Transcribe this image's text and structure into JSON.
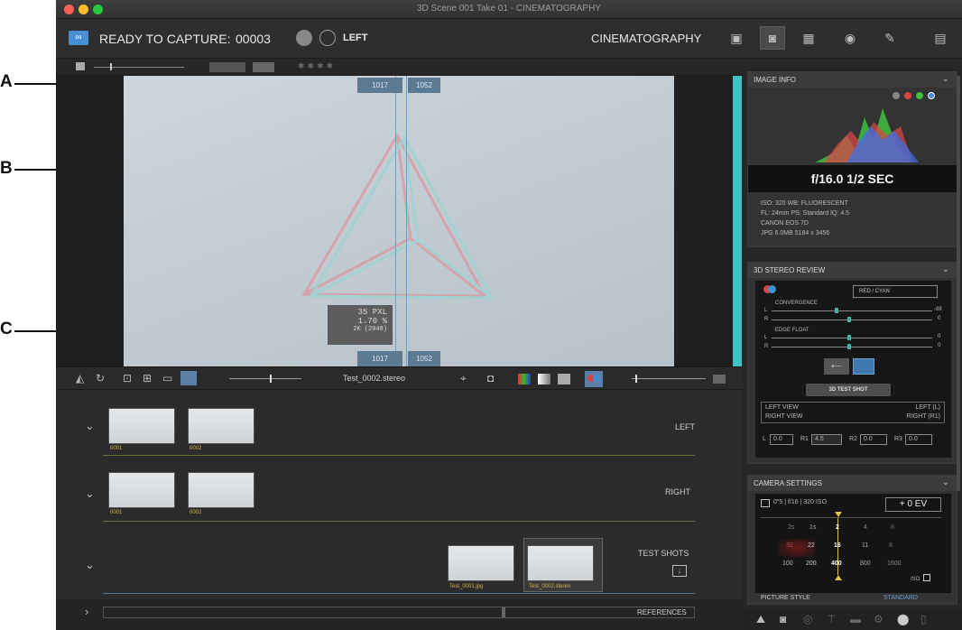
{
  "callouts": {
    "a": "A",
    "b": "B",
    "c": "C"
  },
  "window": {
    "title": "3D Scene 001 Take 01 - CINEMATOGRAPHY"
  },
  "topbar": {
    "status": "READY TO CAPTURE:",
    "counter": "00003",
    "view": "LEFT",
    "mode": "CINEMATOGRAPHY"
  },
  "viewer": {
    "marker_top_left": "1017",
    "marker_top_right": "1052",
    "marker_bottom_left": "1017",
    "marker_bottom_right": "1052",
    "measure_px": "35 PXL",
    "measure_pct": "1.70 %",
    "measure_res": "2K (2048)"
  },
  "toolbar": {
    "filename": "Test_0002.stereo"
  },
  "rows": {
    "left": {
      "label": "LEFT",
      "thumbs": [
        "0001",
        "0002"
      ]
    },
    "right": {
      "label": "RIGHT",
      "thumbs": [
        "0001",
        "0002"
      ]
    },
    "test": {
      "label": "TEST SHOTS",
      "thumbs": [
        "Test_0001.jpg",
        "Test_0002.stereo"
      ]
    },
    "refs": {
      "label": "REFERENCES"
    }
  },
  "image_info": {
    "title": "IMAGE INFO",
    "exposure": "f/16.0  1/2 SEC",
    "line1": "ISO: 320  WB: FLUORESCENT",
    "line2": "FL: 24mm  PS: Standard  IQ: 4.5",
    "line3": "CANON EOS 7D",
    "line4": "JPG  6.0MB  5184 x 3456"
  },
  "stereo": {
    "title": "3D STEREO REVIEW",
    "mode": "RED / CYAN",
    "convergence": "CONVERGENCE",
    "conv_l": "-88",
    "conv_r": "0",
    "edge": "EDGE FLOAT",
    "edge_l": "0",
    "edge_r": "0",
    "ll": "L",
    "rl": "R",
    "test_btn": "3D TEST SHOT",
    "left_view": "LEFT VIEW",
    "left_val": "LEFT (L)",
    "right_view": "RIGHT VIEW",
    "right_val": "RIGHT (R1)",
    "f_l": "L",
    "v_l": "0.0",
    "f_r1": "R1",
    "v_r1": "4.5",
    "f_r2": "R2",
    "v_r2": "0.0",
    "f_r3": "R3",
    "v_r3": "0.0"
  },
  "camera": {
    "title": "CAMERA SETTINGS",
    "summary": "0\"5 | f/16 | 320 ISO",
    "ev": "+ 0 EV",
    "shutter": [
      "2s",
      "1s",
      "2",
      "4",
      "8"
    ],
    "aperture": [
      "32",
      "22",
      "16",
      "11",
      "8"
    ],
    "iso": [
      "100",
      "200",
      "400",
      "800",
      "1600"
    ],
    "iso_lbl": "ISO",
    "style_lbl": "PICTURE STYLE",
    "style_val": "STANDARD"
  },
  "colors": {
    "accent": "#4a8fd4",
    "red": "#d64545",
    "green": "#3fbf3f",
    "cyan": "#3fc3c6"
  }
}
